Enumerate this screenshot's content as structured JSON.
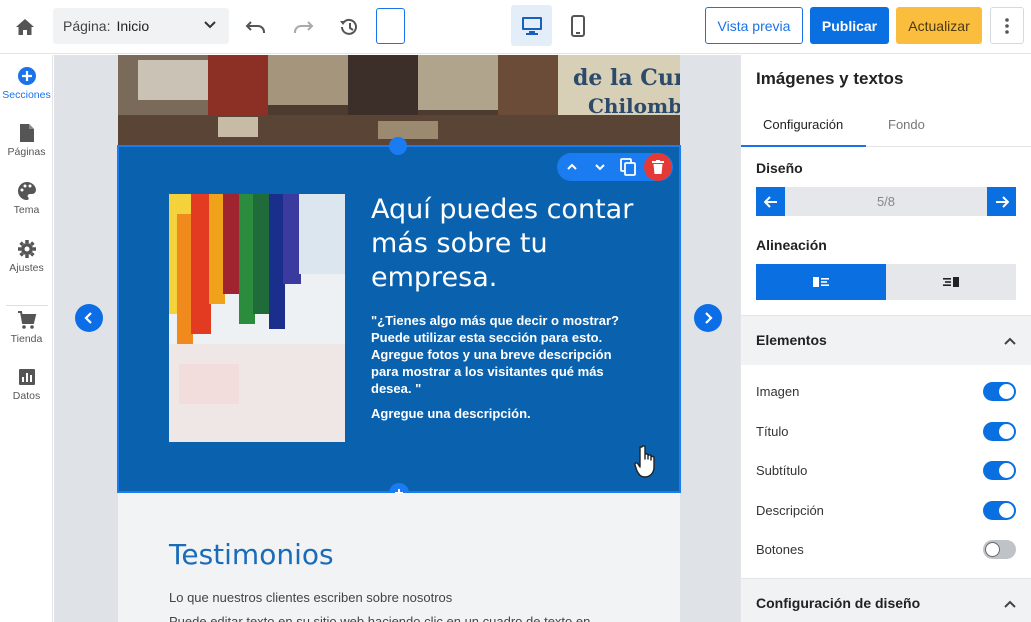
{
  "topbar": {
    "page_label": "Página:",
    "page_value": "Inicio",
    "preview_label": "Vista previa",
    "publish_label": "Publicar",
    "update_label": "Actualizar"
  },
  "sidebar": {
    "items": [
      {
        "label": "Secciones",
        "icon": "plus-circle-icon"
      },
      {
        "label": "Páginas",
        "icon": "page-icon"
      },
      {
        "label": "Tema",
        "icon": "palette-icon"
      },
      {
        "label": "Ajustes",
        "icon": "gear-icon"
      },
      {
        "label": "Tienda",
        "icon": "cart-icon"
      },
      {
        "label": "Datos",
        "icon": "chart-icon"
      }
    ]
  },
  "canvas": {
    "section_title": "Aquí puedes contar más sobre tu empresa.",
    "section_subtitle": "\"¿Tienes algo más que decir o mostrar? Puede utilizar esta sección para esto. Agregue fotos y una breve descripción para mostrar a los visitantes qué más desea. \"",
    "section_description": "Agregue una descripción.",
    "testimonials_title": "Testimonios",
    "testimonials_subtitle": "Lo que nuestros clientes escriben sobre nosotros",
    "testimonials_body": "Puede editar texto en su sitio web haciendo clic en un cuadro de texto en"
  },
  "panel": {
    "title": "Imágenes y textos",
    "tabs": [
      {
        "label": "Configuración",
        "active": true
      },
      {
        "label": "Fondo",
        "active": false
      }
    ],
    "design_label": "Diseño",
    "design_value": "5/8",
    "alignment_label": "Alineación",
    "elements_label": "Elementos",
    "toggles": [
      {
        "label": "Imagen",
        "on": true
      },
      {
        "label": "Título",
        "on": true
      },
      {
        "label": "Subtítulo",
        "on": true
      },
      {
        "label": "Descripción",
        "on": true
      },
      {
        "label": "Botones",
        "on": false
      }
    ],
    "design_config_label": "Configuración de diseño"
  },
  "colors": {
    "accent": "#0a6fe0",
    "section_bg": "#0a62ae",
    "update": "#fbbd3d",
    "delete": "#e53935"
  }
}
